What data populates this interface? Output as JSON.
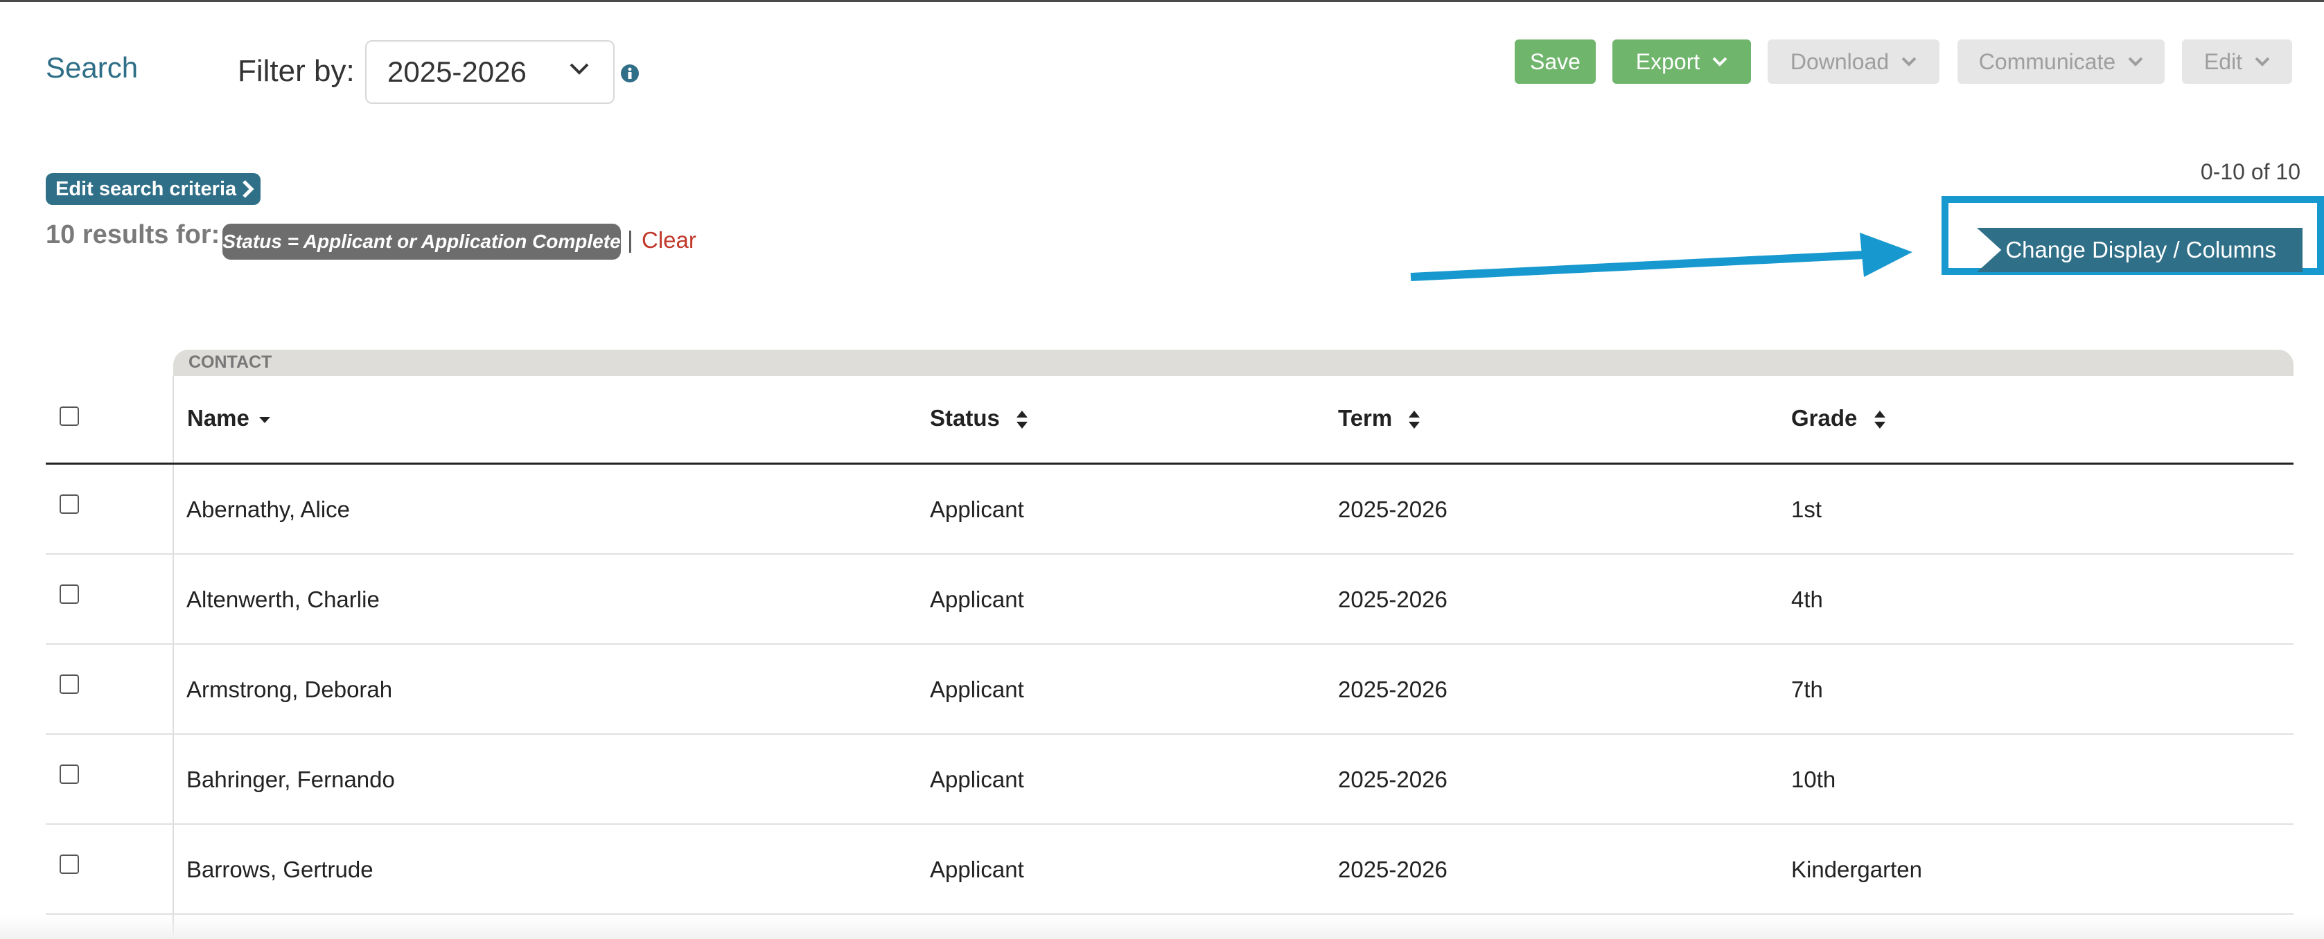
{
  "header": {
    "title": "Search",
    "filter_label": "Filter by:",
    "filter_value": "2025-2026"
  },
  "toolbar": {
    "save_label": "Save",
    "export_label": "Export",
    "download_label": "Download",
    "communicate_label": "Communicate",
    "edit_label": "Edit"
  },
  "criteria": {
    "edit_label": "Edit search criteria",
    "results_label": "10 results for:",
    "chip_text": "Status = Applicant or Application Complete",
    "separator": "|",
    "clear_label": "Clear"
  },
  "pagination": {
    "text": "0-10 of 10"
  },
  "display": {
    "change_columns_label": "Change Display / Columns"
  },
  "table": {
    "group_label": "CONTACT",
    "columns": [
      "Name",
      "Status",
      "Term",
      "Grade"
    ],
    "rows": [
      {
        "name": "Abernathy, Alice",
        "status": "Applicant",
        "term": "2025-2026",
        "grade": "1st"
      },
      {
        "name": "Altenwerth, Charlie",
        "status": "Applicant",
        "term": "2025-2026",
        "grade": "4th"
      },
      {
        "name": "Armstrong, Deborah",
        "status": "Applicant",
        "term": "2025-2026",
        "grade": "7th"
      },
      {
        "name": "Bahringer, Fernando",
        "status": "Applicant",
        "term": "2025-2026",
        "grade": "10th"
      },
      {
        "name": "Barrows, Gertrude",
        "status": "Applicant",
        "term": "2025-2026",
        "grade": "Kindergarten"
      }
    ]
  },
  "colors": {
    "accent": "#2f6f87",
    "green": "#6fb56c",
    "annotation": "#1799cf",
    "clear_link": "#c0392b"
  },
  "icons": {
    "info": "info-icon",
    "dropdown": "chevron-down-icon",
    "sort": "sort-icon",
    "sort_desc": "sort-desc-icon",
    "edit_criteria": "chevron-right-icon"
  }
}
